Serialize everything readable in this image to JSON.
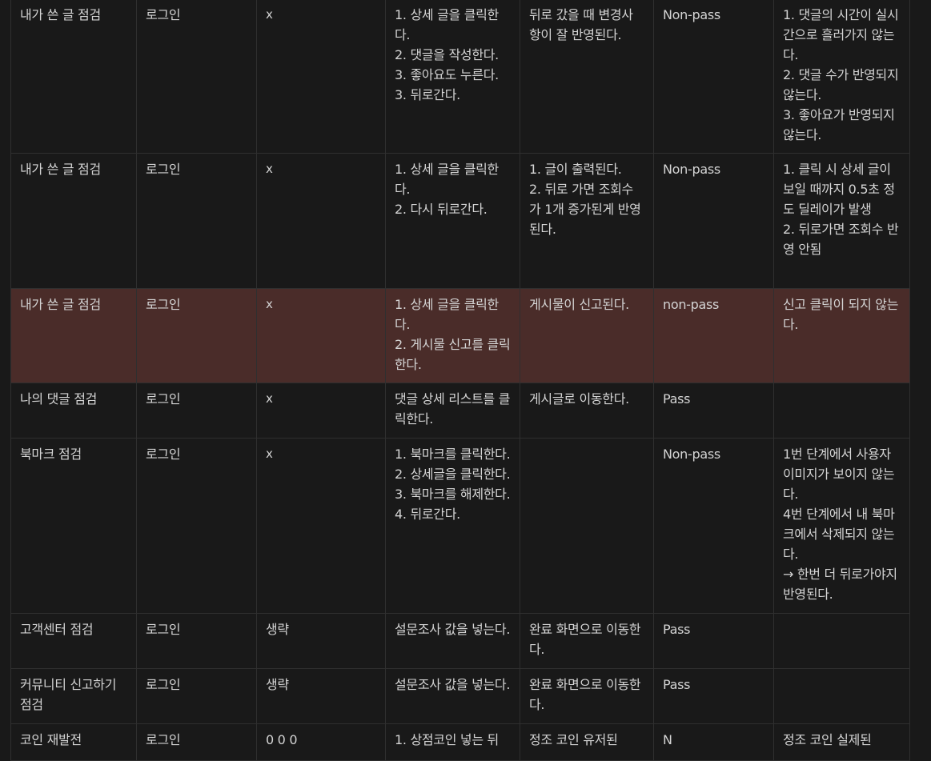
{
  "table": {
    "rows": [
      {
        "feature": "내가 쓴 글 점검",
        "precondition": "로그인",
        "input": "x",
        "steps": "1. 상세 글을 클릭한다.\n2. 댓글을 작성한다.\n3. 좋아요도 누른다.\n3. 뒤로간다.",
        "expected": "뒤로 갔을 때 변경사항이 잘 반영된다.",
        "result": "Non-pass",
        "note": "1. 댓글의 시간이 실시간으로 흘러가지 않는다.\n2. 댓글 수가 반영되지 않는다.\n3. 좋아요가 반영되지 않는다."
      },
      {
        "feature": "내가 쓴 글 점검",
        "precondition": "로그인",
        "input": "x",
        "steps": "1. 상세 글을 클릭한다.\n2. 다시 뒤로간다.",
        "expected": "1. 글이 출력된다.\n2. 뒤로 가면 조회수가 1개 증가된게 반영된다.",
        "result": "Non-pass",
        "note": "1. 클릭 시 상세 글이 보일 때까지 0.5초 정도 딜레이가 발생\n2. 뒤로가면 조회수 반영 안됨"
      },
      {
        "feature": "내가 쓴 글 점검",
        "precondition": "로그인",
        "input": "x",
        "steps": "1. 상세 글을 클릭한다.\n2. 게시물 신고를 클릭한다.",
        "expected": "게시물이 신고된다.",
        "result": "non-pass",
        "note": "신고 클릭이 되지 않는다.",
        "highlight": true
      },
      {
        "feature": "나의 댓글 점검",
        "precondition": "로그인",
        "input": "x",
        "steps": "댓글 상세 리스트를 클릭한다.",
        "expected": "게시글로 이동한다.",
        "result": "Pass",
        "note": ""
      },
      {
        "feature": "북마크 점검",
        "precondition": "로그인",
        "input": "x",
        "steps": "1. 북마크를 클릭한다.\n2. 상세글을 클릭한다.\n3. 북마크를 해제한다.\n4. 뒤로간다.",
        "expected": "",
        "result": "Non-pass",
        "note": "1번 단계에서 사용자 이미지가 보이지 않는다.\n4번 단계에서 내 북마크에서 삭제되지 않는다.\n→ 한번 더 뒤로가야지 반영된다."
      },
      {
        "feature": "고객센터 점검",
        "precondition": "로그인",
        "input": "생략",
        "steps": "설문조사 값을 넣는다.",
        "expected": "완료 화면으로 이동한다.",
        "result": "Pass",
        "note": ""
      },
      {
        "feature": "커뮤니티 신고하기 점검",
        "precondition": "로그인",
        "input": "생략",
        "steps": "설문조사 값을 넣는다.",
        "expected": "완료 화면으로 이동한다.",
        "result": "Pass",
        "note": ""
      },
      {
        "feature": "코인 재발전",
        "precondition": "로그인",
        "input": "0 0 0",
        "steps": "1. 상점코인 넣는 뒤",
        "expected": "정조 코인 유저된",
        "result": "N",
        "note": "정조 코인 실제된"
      }
    ]
  }
}
